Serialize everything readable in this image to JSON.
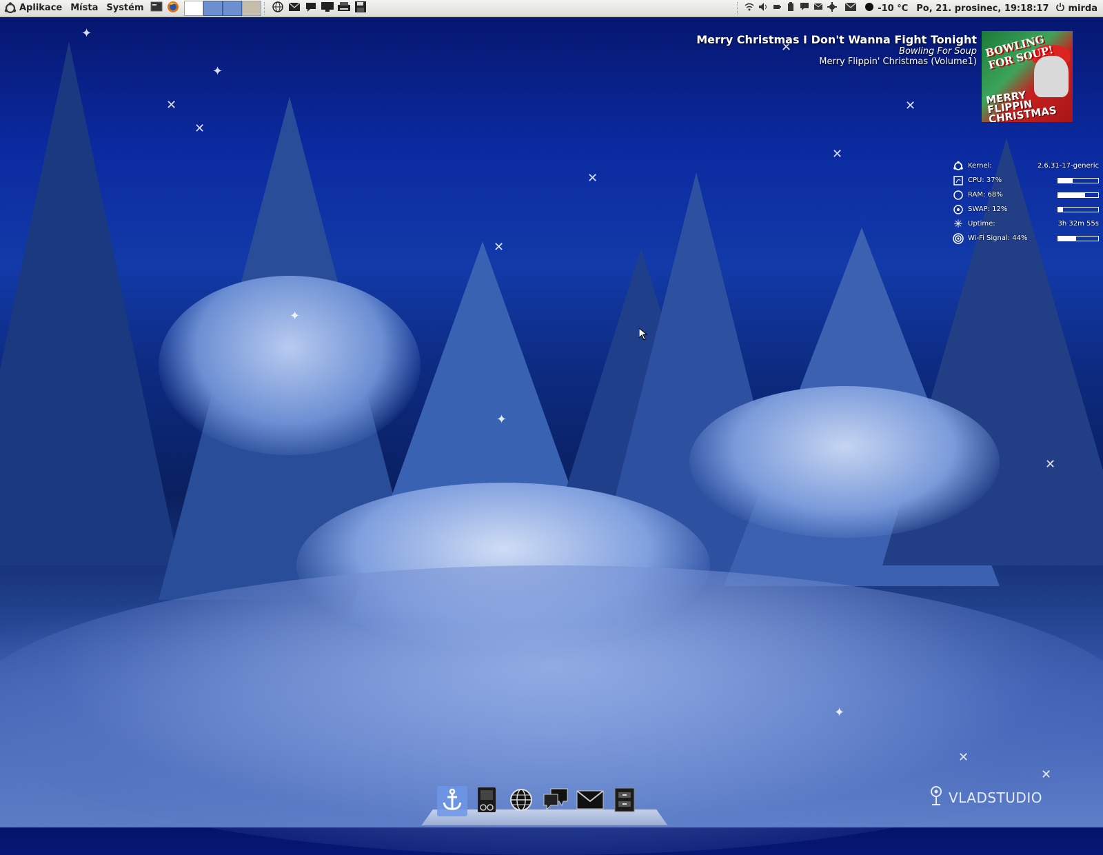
{
  "top_panel": {
    "menus": [
      {
        "label": "Aplikace",
        "icon": "ubuntu-logo-icon"
      },
      {
        "label": "Místa"
      },
      {
        "label": "Systém"
      }
    ],
    "launchers": [
      "terminal-icon",
      "firefox-icon"
    ],
    "workspaces": 4,
    "quick_launchers": [
      "globe-icon",
      "mail-icon",
      "chat-icon",
      "monitor-icon",
      "printer-icon",
      "save-icon"
    ],
    "tray_icons": [
      "wifi-icon",
      "volume-icon",
      "power-icon",
      "battery-icon",
      "chat-icon",
      "mail-icon",
      "gear-icon"
    ],
    "weather_icon": "mail-icon",
    "temperature": "-10 °C",
    "datetime": "Po, 21. prosinec, 19:18:17",
    "user": "mirda"
  },
  "now_playing": {
    "title": "Merry Christmas I Don't Wanna Fight Tonight",
    "artist": "Bowling For Soup",
    "album": "Merry Flippin' Christmas (Volume1)",
    "album_art_text": {
      "band": "BOWLING FOR SOUP!",
      "album": "MERRY FLIPPIN CHRISTMAS"
    }
  },
  "system_monitor": {
    "rows": [
      {
        "label": "Kernel:",
        "value": "2.6.31-17-generic",
        "icon": "ubuntu-logo-icon"
      },
      {
        "label": "CPU: 37%",
        "percent": 37,
        "icon": "cpu-icon"
      },
      {
        "label": "RAM: 68%",
        "percent": 68,
        "icon": "ram-icon"
      },
      {
        "label": "SWAP: 12%",
        "percent": 12,
        "icon": "swap-icon"
      },
      {
        "label": "Uptime:",
        "value": "3h 32m 55s",
        "icon": "snowflake-icon"
      },
      {
        "label": "Wi-Fi Signal: 44%",
        "percent": 44,
        "icon": "wifi-signal-icon"
      }
    ]
  },
  "dock": {
    "items": [
      {
        "name": "anchor-icon",
        "active": true
      },
      {
        "name": "file-manager-icon"
      },
      {
        "name": "globe-icon"
      },
      {
        "name": "chat-icon"
      },
      {
        "name": "mail-icon"
      },
      {
        "name": "drawer-icon"
      }
    ]
  },
  "watermark": "VLADSTUDIO",
  "colors": {
    "sky_top": "#05146a",
    "sky_mid": "#123aa8",
    "snow": "#5e7fc8",
    "panel": "#e8e8e6",
    "dock_active": "#6e96e6"
  }
}
